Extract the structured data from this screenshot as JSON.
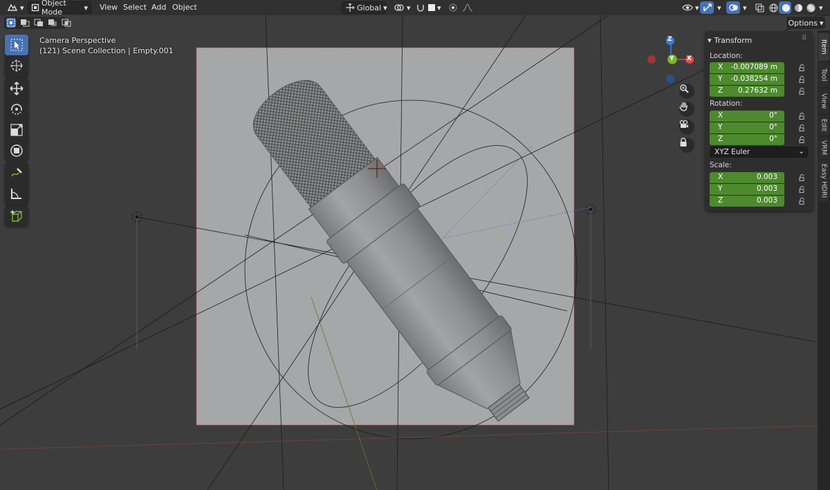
{
  "header": {
    "mode_label": "Object Mode",
    "menu": [
      "View",
      "Select",
      "Add",
      "Object"
    ],
    "orientation_label": "Global",
    "icons": [
      "editor-type-icon",
      "mode-icon",
      "transform-orientation-icon",
      "snap-icon",
      "proportional-edit-icon",
      "visibility-icon",
      "gizmo-icon",
      "overlay-icon",
      "xray-icon",
      "shading-wireframe-icon",
      "shading-solid-icon",
      "shading-material-icon",
      "shading-rendered-icon"
    ]
  },
  "options_label": "Options",
  "viewport": {
    "view_name": "Camera Perspective",
    "collection_info": "(121) Scene Collection | Empty.001",
    "gizmo_axes": {
      "z": "Z",
      "x": "X",
      "y": "Y"
    },
    "colors": {
      "x": "#e0494f",
      "y": "#7fb733",
      "z": "#3f7ed6",
      "selection": "#e0494f"
    }
  },
  "toolbar": {
    "tools": [
      "select-box-icon",
      "cursor-icon",
      "move-icon",
      "rotate-icon",
      "scale-icon",
      "transform-icon",
      "annotate-icon",
      "measure-icon",
      "add-cube-icon"
    ]
  },
  "transform": {
    "title": "Transform",
    "location_label": "Location:",
    "location": [
      {
        "axis": "X",
        "value": "-0.007089 m"
      },
      {
        "axis": "Y",
        "value": "-0.038254 m"
      },
      {
        "axis": "Z",
        "value": "0.27632 m"
      }
    ],
    "rotation_label": "Rotation:",
    "rotation": [
      {
        "axis": "X",
        "value": "0°"
      },
      {
        "axis": "Y",
        "value": "0°"
      },
      {
        "axis": "Z",
        "value": "0°"
      }
    ],
    "rotation_mode": "XYZ Euler",
    "scale_label": "Scale:",
    "scale": [
      {
        "axis": "X",
        "value": "0.003"
      },
      {
        "axis": "Y",
        "value": "0.003"
      },
      {
        "axis": "Z",
        "value": "0.003"
      }
    ],
    "field_color": "#4d8a2e"
  },
  "sidebar_tabs": [
    "Item",
    "Tool",
    "View",
    "Edit",
    "VRM",
    "Easy HDRI"
  ]
}
